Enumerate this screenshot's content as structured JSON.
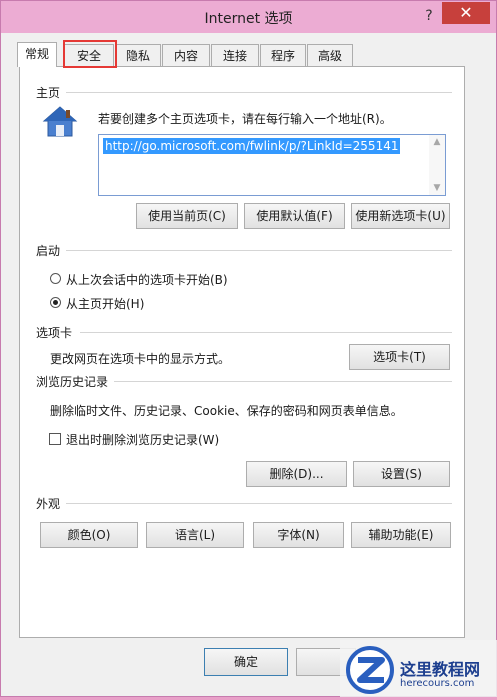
{
  "window": {
    "title": "Internet 选项",
    "help": "?",
    "close": "✕"
  },
  "tabs": [
    "常规",
    "安全",
    "隐私",
    "内容",
    "连接",
    "程序",
    "高级"
  ],
  "home": {
    "section": "主页",
    "description": "若要创建多个主页选项卡，请在每行输入一个地址(R)。",
    "url": "http://go.microsoft.com/fwlink/p/?LinkId=255141",
    "buttons": [
      "使用当前页(C)",
      "使用默认值(F)",
      "使用新选项卡(U)"
    ]
  },
  "startup": {
    "section": "启动",
    "options": [
      "从上次会话中的选项卡开始(B)",
      "从主页开始(H)"
    ]
  },
  "tabs_section": {
    "section": "选项卡",
    "description": "更改网页在选项卡中的显示方式。",
    "button": "选项卡(T)"
  },
  "history": {
    "section": "浏览历史记录",
    "description": "删除临时文件、历史记录、Cookie、保存的密码和网页表单信息。",
    "checkbox": "退出时删除浏览历史记录(W)",
    "delete_button": "删除(D)...",
    "settings_button": "设置(S)"
  },
  "appearance": {
    "section": "外观",
    "buttons": [
      "颜色(O)",
      "语言(L)",
      "字体(N)",
      "辅助功能(E)"
    ]
  },
  "footer": {
    "ok": "确定"
  },
  "watermark": {
    "name": "这里教程网",
    "url": "herecours.com"
  },
  "colors": {
    "titlebar": "#ecacd3",
    "close": "#c7403c",
    "highlight": "#e53935",
    "selection": "#3399ff"
  }
}
